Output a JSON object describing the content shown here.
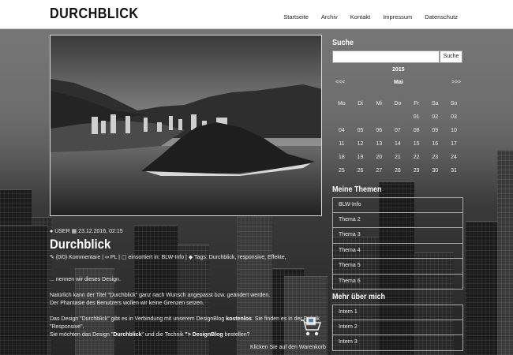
{
  "header": {
    "logo": "DURCHBLICK",
    "nav": [
      "Startseite",
      "Archiv",
      "Kontakt",
      "Impressum",
      "Datenschutz"
    ]
  },
  "post": {
    "author": "USER",
    "date": "23.12.2016, 02:15",
    "title": "Durchblick",
    "comments": "(0/0) Kommentare",
    "pl": "PL",
    "category_prefix": "einsortiert in:",
    "category": "BLW-Info",
    "tags_prefix": "Tags:",
    "tags": "Durchblick, responsive, Effekte,",
    "intro": "... nennen wir dieses Design.",
    "p1_line1": "Natürlich kann der Titel \"Durchblick\" ganz nach Wunsch angepasst bzw. geändert werden.",
    "p1_line2": "Der Phantasie des Benutzers wollen wir keine Grenzen setzen.",
    "p2_a": "Das Design \"Durchblick\" gibt es in Verbindung mit unserem DesignBlog ",
    "p2_bold": "kostenlos",
    "p2_b": ". Sie finden es in der Rubrik",
    "p2_line2": "\"Responsive\".",
    "p3_a": "Sie möchten das Design \"",
    "p3_bold1": "Durchblick",
    "p3_b": "\" und die Technik ",
    "p3_bold2": "\"> DesignBlog",
    "p3_c": " bestellen?",
    "cart_text": "Klicken Sie auf den Warenkorb"
  },
  "sidebar": {
    "search_title": "Suche",
    "search_button": "Suche",
    "search_value": "",
    "calendar": {
      "year": "2015",
      "month": "Mai",
      "prev": "<<<",
      "next": ">>>",
      "weekdays": [
        "Mo",
        "Di",
        "Mi",
        "Do",
        "Fr",
        "Sa",
        "So"
      ],
      "weeks": [
        [
          "",
          "",
          "",
          "",
          "01",
          "02",
          "03"
        ],
        [
          "04",
          "05",
          "06",
          "07",
          "08",
          "09",
          "10"
        ],
        [
          "11",
          "12",
          "13",
          "14",
          "15",
          "16",
          "17"
        ],
        [
          "18",
          "19",
          "20",
          "21",
          "22",
          "23",
          "24"
        ],
        [
          "25",
          "26",
          "27",
          "28",
          "29",
          "30",
          "31"
        ]
      ]
    },
    "themes_title": "Meine Themen",
    "themes": [
      "BLW-Info",
      "Thema 2",
      "Thema 3",
      "Thema 4",
      "Thema 5",
      "Thema 6"
    ],
    "more_title": "Mehr über mich",
    "more": [
      "Intern 1",
      "Intern 2",
      "Intern 3"
    ]
  }
}
